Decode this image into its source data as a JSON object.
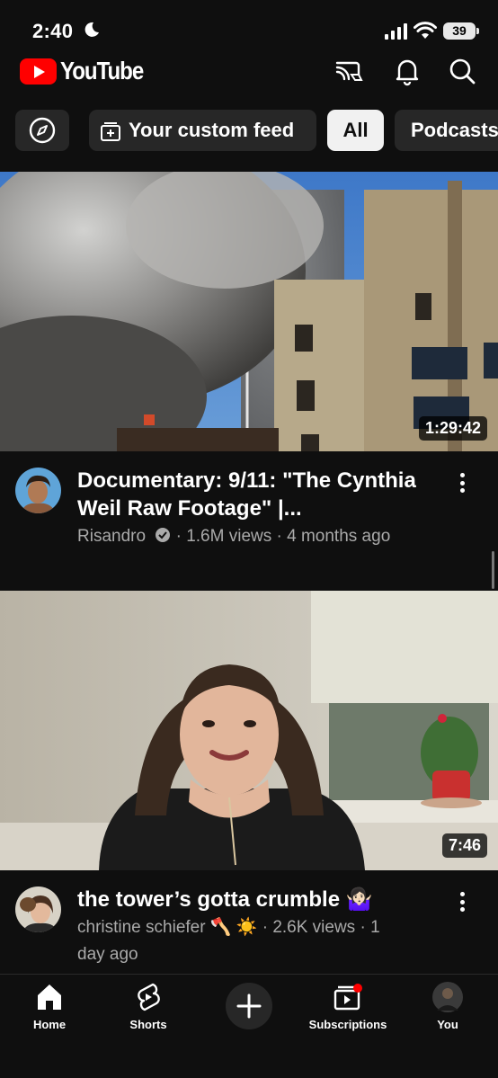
{
  "status_bar": {
    "time": "2:40",
    "battery": "39"
  },
  "header": {
    "logo_text": "YouTube"
  },
  "chips": {
    "custom_feed": "Your custom feed",
    "all": "All",
    "podcasts": "Podcasts"
  },
  "videos": [
    {
      "title": "Documentary: 9/11: \"The Cynthia Weil Raw Footage\" |...",
      "channel": "Risandro",
      "verified": true,
      "meta": " · 1.6M views · 4 months ago",
      "duration": "1:29:42"
    },
    {
      "title": "the tower’s gotta crumble 🤷🏻‍♀️",
      "channel": "christine schiefer",
      "meta_line1": "christine schiefer 🪓 ☀️ · 2.6K views · 1",
      "meta_line2": "day ago",
      "duration": "7:46"
    }
  ],
  "bottom_nav": {
    "home": "Home",
    "shorts": "Shorts",
    "subscriptions": "Subscriptions",
    "you": "You"
  },
  "colors": {
    "brand_red": "#ff0000",
    "background": "#0f0f0f",
    "chip_bg": "#272727",
    "chip_selected_bg": "#f1f1f1",
    "meta_text": "#aaaaaa"
  }
}
